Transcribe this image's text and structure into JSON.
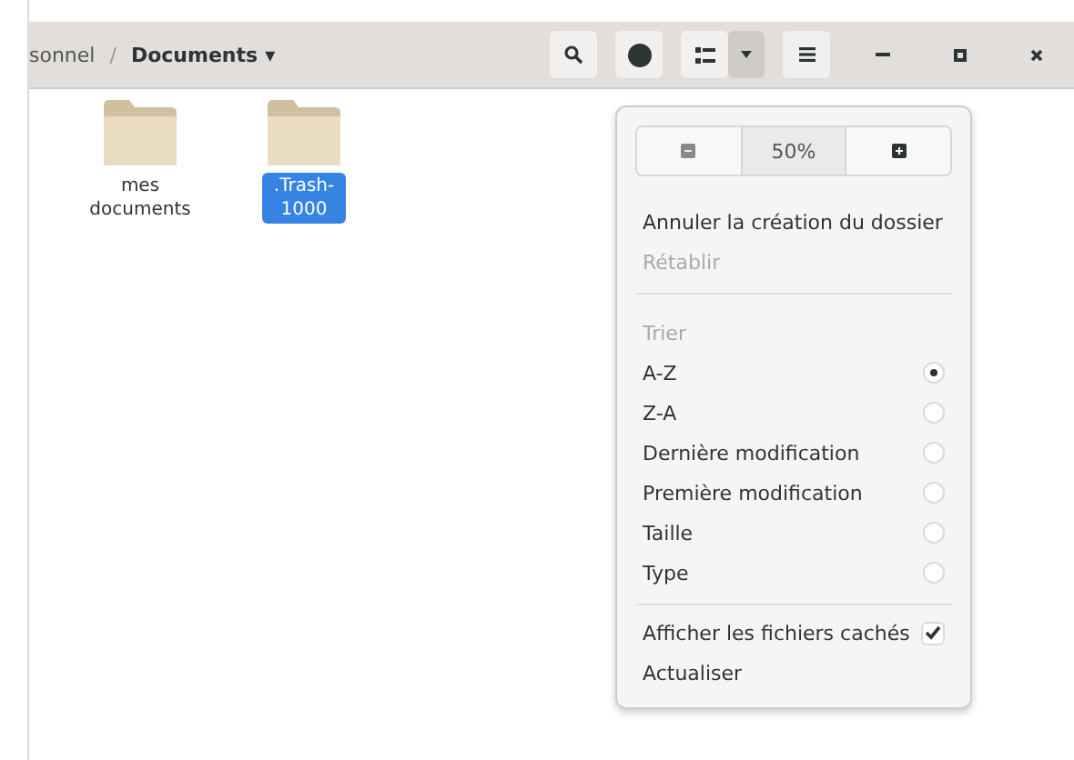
{
  "breadcrumb": {
    "parent": "sonnel",
    "separator": "/",
    "current": "Documents",
    "caret": "▾"
  },
  "view_menu_button": {
    "expanded": true
  },
  "files": [
    {
      "name": "mes documents",
      "selected": false
    },
    {
      "name": ".Trash-1000",
      "selected": true
    }
  ],
  "menu": {
    "zoom_label": "50%",
    "items": [
      {
        "kind": "action",
        "label": "Annuler la création du dossier",
        "disabled": false
      },
      {
        "kind": "action",
        "label": "Rétablir",
        "disabled": true
      },
      {
        "kind": "divider"
      },
      {
        "kind": "heading",
        "label": "Trier"
      },
      {
        "kind": "radio",
        "label": "A-Z",
        "selected": true
      },
      {
        "kind": "radio",
        "label": "Z-A",
        "selected": false
      },
      {
        "kind": "radio",
        "label": "Dernière modification",
        "selected": false
      },
      {
        "kind": "radio",
        "label": "Première modification",
        "selected": false
      },
      {
        "kind": "radio",
        "label": "Taille",
        "selected": false
      },
      {
        "kind": "radio",
        "label": "Type",
        "selected": false
      },
      {
        "kind": "divider"
      },
      {
        "kind": "check",
        "label": "Afficher les fichiers cachés",
        "checked": true
      },
      {
        "kind": "action",
        "label": "Actualiser",
        "disabled": false
      }
    ]
  }
}
